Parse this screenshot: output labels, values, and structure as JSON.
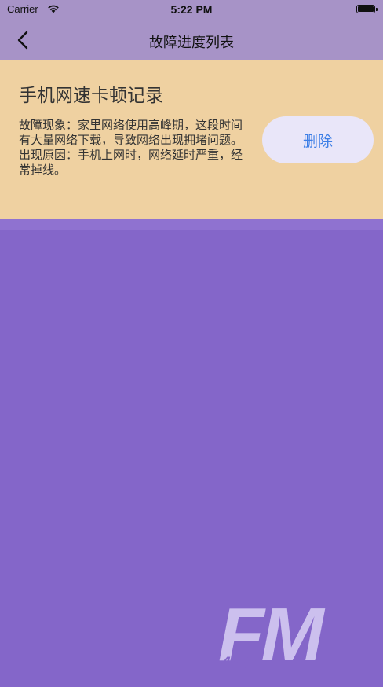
{
  "status_bar": {
    "carrier": "Carrier",
    "time": "5:22 PM"
  },
  "nav": {
    "title": "故障进度列表",
    "back_icon": "chevron-left-icon"
  },
  "record": {
    "title": "手机网速卡顿记录",
    "phenomenon": "故障现象：家里网络使用高峰期，这段时间有大量网络下载，导致网络出现拥堵问题。",
    "cause": "出现原因：手机上网时，网络延时严重，经常掉线。",
    "delete_label": "删除"
  },
  "watermark": {
    "logo_text": "FM",
    "logo_number": "4399"
  },
  "colors": {
    "background": "#8466c9",
    "nav_background": "#a793c7",
    "card_background": "#efd1a1",
    "button_background": "#e9e6f9",
    "button_text": "#3c7ee6"
  }
}
